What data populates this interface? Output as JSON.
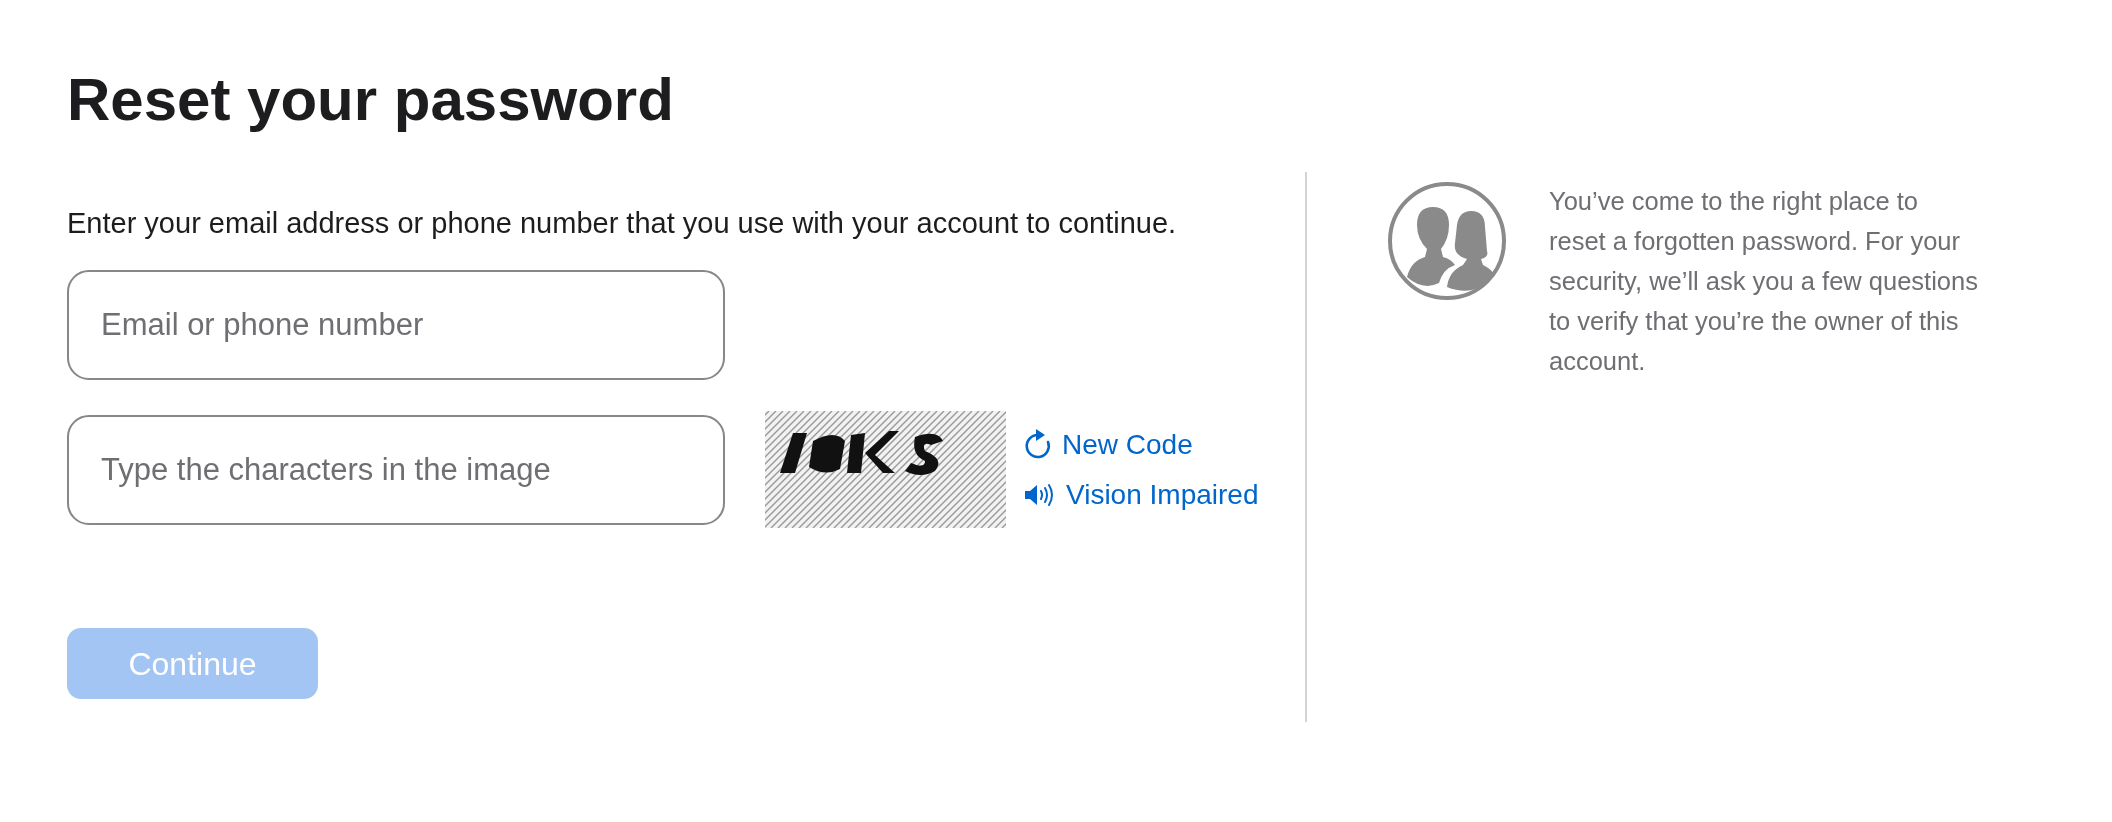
{
  "title": "Reset your password",
  "intro": "Enter your email address or phone number that you use with your account to continue.",
  "fields": [
    {
      "placeholder": "Email or phone number"
    },
    {
      "placeholder": "Type the characters in the image"
    }
  ],
  "captcha": {
    "kind": "picture",
    "links": [
      {
        "kind": "refresh",
        "label": "New Code"
      },
      {
        "kind": "audio",
        "label": "Vision Impaired"
      }
    ]
  },
  "continue_button": {
    "label": "Continue",
    "disabled": true
  },
  "aside": {
    "text": "You’ve come to the right place to reset a forgotten password. For your security, we’ll ask you a few questions to verify that you’re the owner of this account."
  }
}
